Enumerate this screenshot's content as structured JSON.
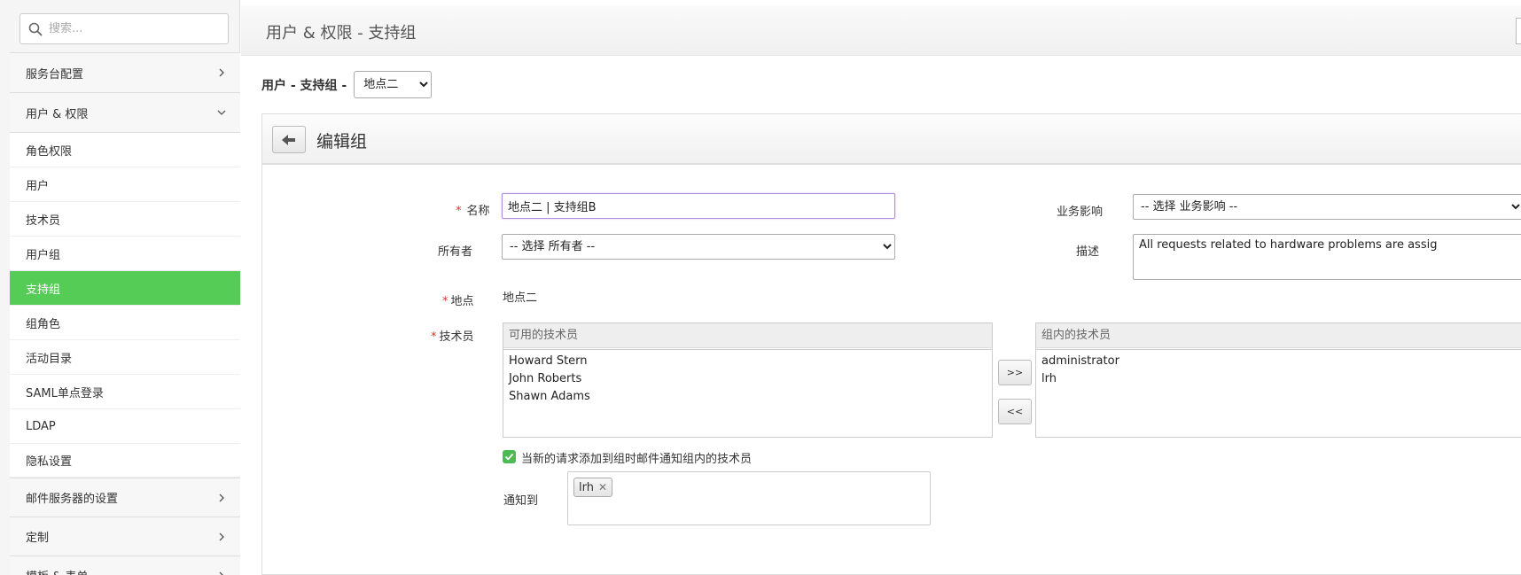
{
  "sidebar": {
    "search_placeholder": "搜索...",
    "groups": {
      "service_desk": "服务台配置",
      "users_permissions": "用户 & 权限",
      "mail_server": "邮件服务器的设置",
      "customize": "定制",
      "templates": "模板 & 表单"
    },
    "items": [
      {
        "label": "角色权限"
      },
      {
        "label": "用户"
      },
      {
        "label": "技术员"
      },
      {
        "label": "用户组"
      },
      {
        "label": "支持组"
      },
      {
        "label": "组角色"
      },
      {
        "label": "活动目录"
      },
      {
        "label": "SAML单点登录"
      },
      {
        "label": "LDAP"
      },
      {
        "label": "隐私设置"
      }
    ],
    "active_color": "#55cc55"
  },
  "header": {
    "page_title": "用户 & 权限 - 支持组"
  },
  "group_select": {
    "label": "用户 - 支持组 -",
    "selected": "地点二"
  },
  "panel": {
    "title": "编辑组"
  },
  "form": {
    "name_label": "名称",
    "name_value": "地点二 | 支持组B",
    "owner_label": "所有者",
    "owner_value": "-- 选择 所有者 --",
    "impact_label": "业务影响",
    "impact_value": "-- 选择 业务影响 --",
    "desc_label": "描述",
    "desc_value": "All requests related to hardware problems are assig",
    "site_label": "地点",
    "site_value": "地点二",
    "tech_label": "技术员",
    "available_header": "可用的技术员",
    "available": [
      "Howard Stern",
      "John Roberts",
      "Shawn Adams"
    ],
    "in_group_header": "组内的技术员",
    "in_group": [
      "administrator",
      "lrh"
    ],
    "move_right": ">>",
    "move_left": "<<",
    "notify_checkbox_label": "当新的请求添加到组时邮件通知组内的技术员",
    "notify_checked": true,
    "notify_to_label": "通知到",
    "notify_tags": [
      "lrh"
    ],
    "required_mark": "*"
  }
}
